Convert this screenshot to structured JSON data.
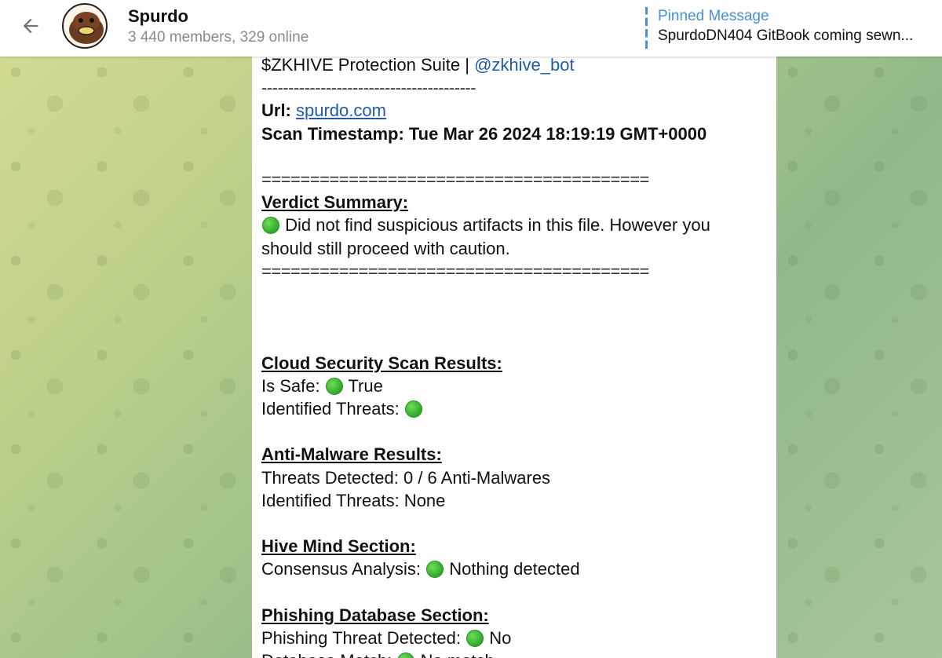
{
  "header": {
    "title": "Spurdo",
    "subtitle": "3 440 members, 329 online",
    "pinned_label": "Pinned Message",
    "pinned_text": "SpurdoDN404 GitBook coming sewn..."
  },
  "message": {
    "line1_prefix": "$ZKHIVE Protection Suite | ",
    "line1_link": "@zkhive_bot",
    "separator_short": "----------------------------------------",
    "url_label": "Url: ",
    "url_value": "spurdo.com",
    "timestamp": "Scan Timestamp: Tue Mar 26 2024 18:19:19 GMT+0000",
    "separator_long": "========================================",
    "verdict_heading": "Verdict Summary:",
    "verdict_line1": "Did not find suspicious artifacts in this file. However you",
    "verdict_line2": "should still proceed with caution.",
    "cloud_heading": "Cloud Security Scan Results:",
    "is_safe_label": "Is Safe: ",
    "is_safe_value": "True",
    "identified_threats_label": "Identified Threats: ",
    "antimalware_heading": "Anti-Malware Results:",
    "threats_detected": "Threats Detected: 0 / 6 Anti-Malwares",
    "identified_threats_none": "Identified Threats: None",
    "hive_heading": "Hive Mind Section:",
    "consensus_label": "Consensus Analysis: ",
    "consensus_value": "Nothing detected",
    "phishing_heading": "Phishing Database Section:",
    "phishing_label": "Phishing Threat Detected: ",
    "phishing_value": "No",
    "db_match_label": "Database Match: ",
    "db_match_value": "No match"
  },
  "icons": {
    "back": "arrow-left-icon",
    "status_dot": "green-circle-icon"
  },
  "colors": {
    "accent": "#4a8fd6",
    "link": "#1e5ba8",
    "status_green": "#2fa82a"
  }
}
